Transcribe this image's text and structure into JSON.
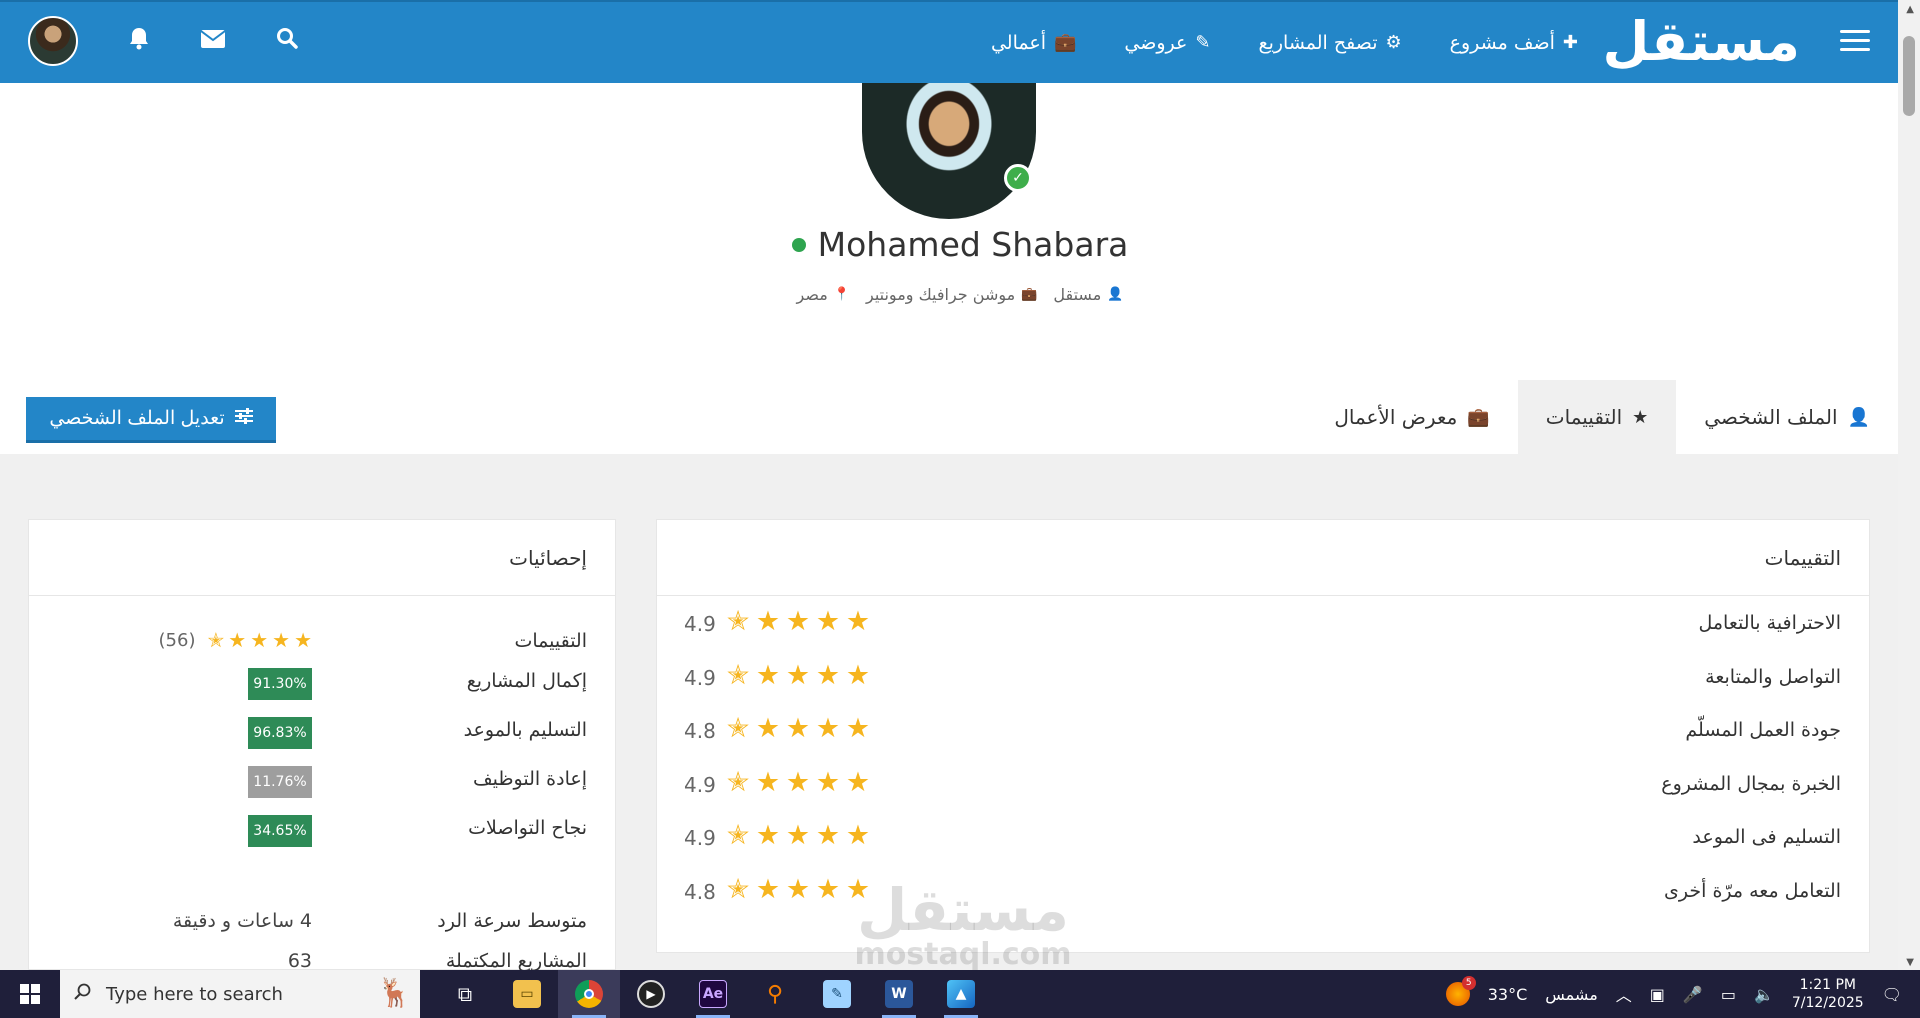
{
  "nav": {
    "logo": "مستقل",
    "links": [
      {
        "label": "أضف مشروع",
        "icon": "✚"
      },
      {
        "label": "تصفح المشاريع",
        "icon": "⚙"
      },
      {
        "label": "عروضي",
        "icon": "✎"
      },
      {
        "label": "أعمالي",
        "icon": "💼"
      }
    ],
    "icons": [
      "search-icon",
      "envelope-icon",
      "bell-icon"
    ]
  },
  "profile": {
    "name": "Mohamed Shabara",
    "meta": {
      "role": "مستقل",
      "specialty": "موشن جرافيك ومونتير",
      "country": "مصر"
    }
  },
  "tabs": [
    {
      "label": "الملف الشخصي",
      "icon": "👤"
    },
    {
      "label": "التقييمات",
      "icon": "★"
    },
    {
      "label": "معرض الأعمال",
      "icon": "💼"
    }
  ],
  "active_tab": 1,
  "edit_button": {
    "label": "تعديل الملف الشخصي",
    "icon": "☰"
  },
  "ratings": {
    "title": "التقييمات",
    "items": [
      {
        "label": "الاحترافية بالتعامل",
        "score": "4.9",
        "stars": 4.9
      },
      {
        "label": "التواصل والمتابعة",
        "score": "4.9",
        "stars": 4.9
      },
      {
        "label": "جودة العمل المسلّم",
        "score": "4.8",
        "stars": 4.8
      },
      {
        "label": "الخبرة بمجال المشروع",
        "score": "4.9",
        "stars": 4.9
      },
      {
        "label": "التسليم فى الموعد",
        "score": "4.9",
        "stars": 4.9
      },
      {
        "label": "التعامل معه مرّة أخرى",
        "score": "4.8",
        "stars": 4.8
      }
    ]
  },
  "stats": {
    "title": "إحصائيات",
    "ratings_label": "التقييمات",
    "ratings_count": "(56)",
    "badges": [
      {
        "label": "إكمال المشاريع",
        "value": "91.30%",
        "color": "#2e8b57"
      },
      {
        "label": "التسليم بالموعد",
        "value": "96.83%",
        "color": "#2e8b57"
      },
      {
        "label": "إعادة التوظيف",
        "value": "11.76%",
        "color": "#9e9e9e"
      },
      {
        "label": "نجاح التواصلات",
        "value": "34.65%",
        "color": "#2e8b57"
      }
    ],
    "response_label": "متوسط سرعة الرد",
    "response_value": "4 ساعات و دقيقة",
    "completed_label": "المشاريع المكتملة",
    "completed_value": "63"
  },
  "watermark": {
    "arabic": "مستقل",
    "latin": "mostaql.com"
  },
  "taskbar": {
    "search_placeholder": "Type here to search",
    "weather_temp": "33°C",
    "weather_desc": "مشمس",
    "weather_badge": "5",
    "time": "1:21 PM",
    "date": "7/12/2025"
  },
  "colors": {
    "brand": "#2386c8",
    "star": "#f6b51f",
    "online": "#2ea44f"
  }
}
